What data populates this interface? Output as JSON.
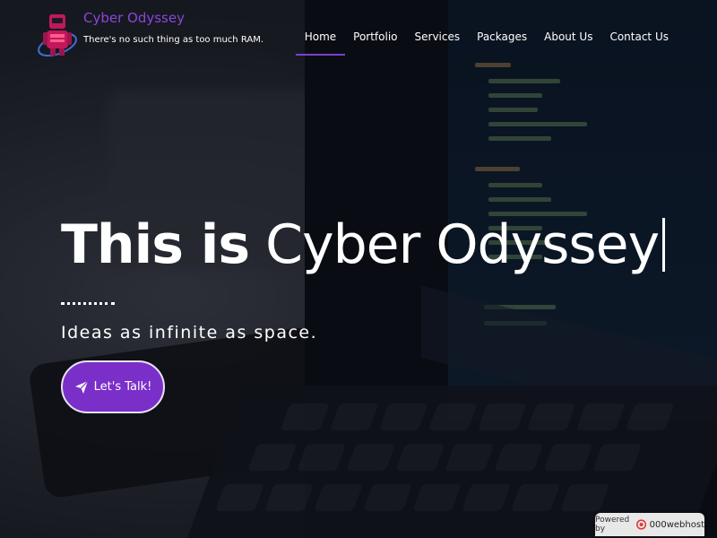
{
  "header": {
    "brand_title": "Cyber Odyssey",
    "tagline": "There's no such thing as too much RAM."
  },
  "nav": {
    "items": [
      {
        "label": "Home",
        "active": true
      },
      {
        "label": "Portfolio"
      },
      {
        "label": "Services"
      },
      {
        "label": "Packages"
      },
      {
        "label": "About Us"
      },
      {
        "label": "Contact Us"
      }
    ]
  },
  "hero": {
    "title_bold": "This is",
    "title_light": "Cyber Odyssey",
    "subtitle": "Ideas as infinite as space.",
    "cta_label": "Let's Talk!",
    "cta_icon": "paper-plane-icon"
  },
  "footer": {
    "powered_by": "Powered by",
    "host_brand": "000webhost"
  },
  "colors": {
    "accent": "#7b2fc9",
    "brand_title": "#8a46d6",
    "nav_underline": "#7b3fd0"
  }
}
